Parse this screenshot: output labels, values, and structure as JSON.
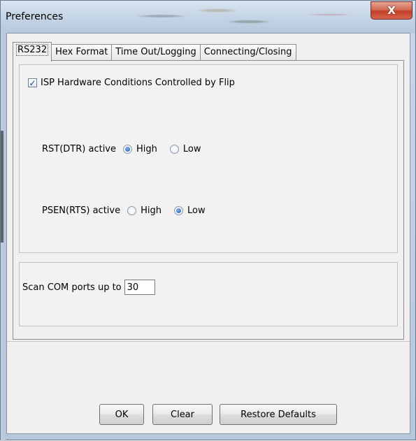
{
  "window": {
    "title": "Preferences",
    "close_glyph": "X"
  },
  "tabs": [
    {
      "label": "RS232",
      "active": true
    },
    {
      "label": "Hex Format",
      "active": false
    },
    {
      "label": "Time Out/Logging",
      "active": false
    },
    {
      "label": "Connecting/Closing",
      "active": false
    }
  ],
  "rs232": {
    "isp_checkbox": {
      "label": "ISP Hardware Conditions Controlled by Flip",
      "checked": true
    },
    "rst": {
      "label": "RST(DTR) active",
      "options": [
        "High",
        "Low"
      ],
      "selected": "High"
    },
    "psen": {
      "label": "PSEN(RTS) active",
      "options": [
        "High",
        "Low"
      ],
      "selected": "Low"
    },
    "scan": {
      "label": "Scan COM ports up to",
      "value": "30"
    }
  },
  "buttons": {
    "ok": "OK",
    "clear": "Clear",
    "restore": "Restore Defaults"
  },
  "icons": {
    "close": "close-icon",
    "check": "checkmark-icon"
  },
  "colors": {
    "radio_selected": "#1f5bb0",
    "close_button": "#c2402a"
  }
}
